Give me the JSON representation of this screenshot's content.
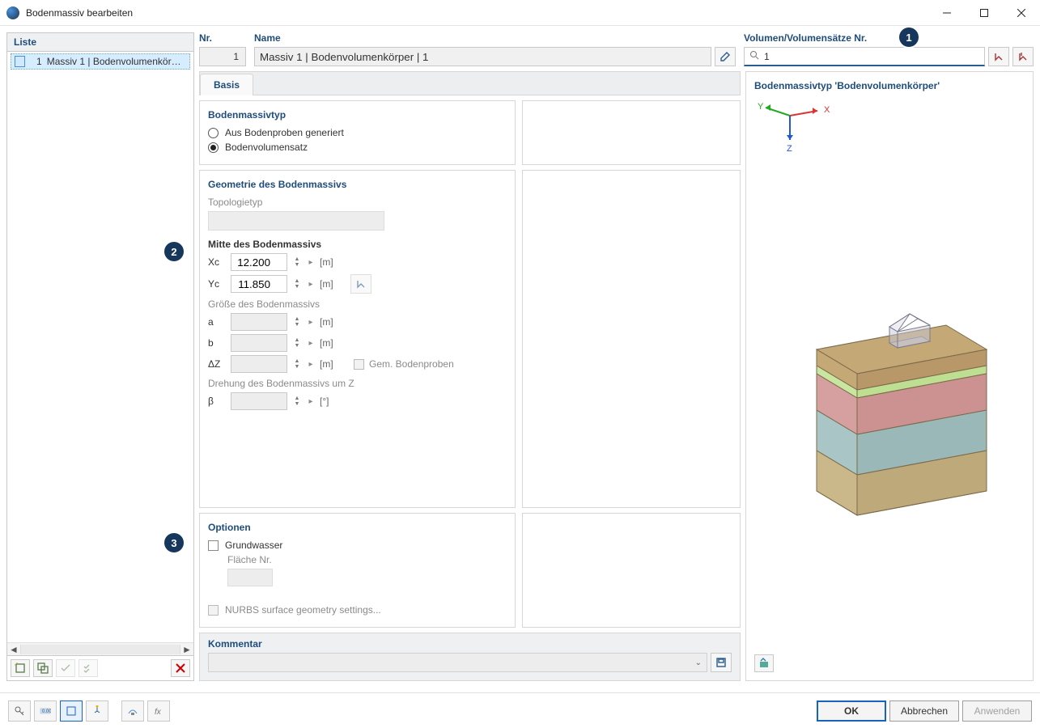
{
  "window": {
    "title": "Bodenmassiv bearbeiten"
  },
  "left": {
    "header": "Liste",
    "rows": [
      {
        "num": "1",
        "label": "Massiv 1 | Bodenvolumenkörper | 1"
      }
    ]
  },
  "header": {
    "nr_label": "Nr.",
    "nr_value": "1",
    "name_label": "Name",
    "name_value": "Massiv 1 | Bodenvolumenkörper | 1",
    "vol_label": "Volumen/Volumensätze Nr.",
    "vol_value": "1"
  },
  "tabs": {
    "basis": "Basis"
  },
  "type": {
    "section": "Bodenmassivtyp",
    "opt_samples": "Aus Bodenproben generiert",
    "opt_set": "Bodenvolumensatz"
  },
  "geom": {
    "section": "Geometrie des Bodenmassivs",
    "topo_label": "Topologietyp",
    "center_label": "Mitte des Bodenmassivs",
    "xc_label": "Xc",
    "xc_value": "12.200",
    "yc_label": "Yc",
    "yc_value": "11.850",
    "unit_m": "[m]",
    "size_label": "Größe des Bodenmassivs",
    "a_label": "a",
    "b_label": "b",
    "dz_label": "ΔZ",
    "gem_label": "Gem. Bodenproben",
    "rot_label": "Drehung des Bodenmassivs um Z",
    "beta_label": "β",
    "unit_deg": "[°]"
  },
  "options": {
    "section": "Optionen",
    "gw_label": "Grundwasser",
    "area_label": "Fläche Nr.",
    "nurbs_label": "NURBS surface geometry settings..."
  },
  "comment": {
    "section": "Kommentar"
  },
  "preview": {
    "title": "Bodenmassivtyp 'Bodenvolumenkörper'",
    "axes": {
      "x": "X",
      "y": "Y",
      "z": "Z"
    }
  },
  "callouts": {
    "c1": "1",
    "c2": "2",
    "c3": "3"
  },
  "buttons": {
    "ok": "OK",
    "cancel": "Abbrechen",
    "apply": "Anwenden"
  }
}
